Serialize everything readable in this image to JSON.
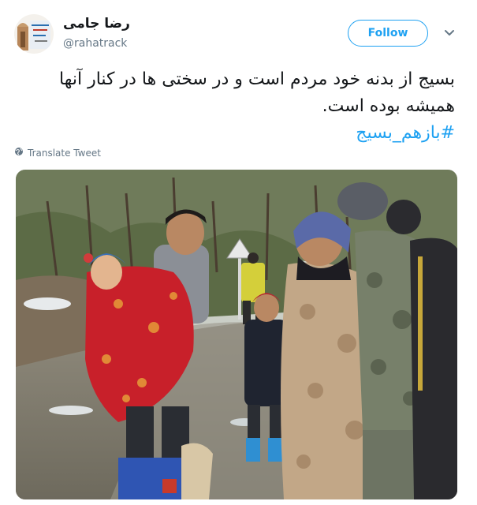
{
  "header": {
    "display_name": "رضا جامی",
    "handle": "@rahatrack",
    "follow_label": "Follow",
    "chevron_icon": "chevron-down-icon",
    "avatar_icon": "profile-avatar"
  },
  "tweet": {
    "line1": "بسیج از بدنه خود مردم است و در سختی ها در کنار آنها",
    "line2": "همیشه بوده است.",
    "hashtag": "#بازهم_بسیج"
  },
  "translate": {
    "label": "Translate Tweet",
    "icon": "globe-icon"
  },
  "photo": {
    "alt": "tweet-photo"
  },
  "colors": {
    "accent": "#1da1f2",
    "secondary_text": "#657786",
    "primary_text": "#14171a"
  }
}
